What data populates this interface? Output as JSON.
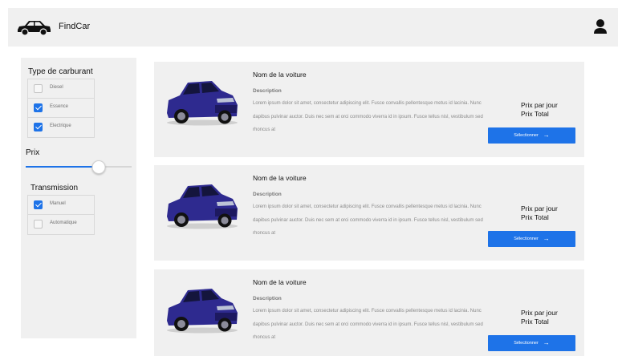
{
  "header": {
    "brand": "FindCar",
    "logo_icon": "car-icon",
    "user_icon": "user-icon"
  },
  "filters": {
    "fuel": {
      "title": "Type de carburant",
      "options": [
        {
          "label": "Diesel",
          "checked": false
        },
        {
          "label": "Essence",
          "checked": true
        },
        {
          "label": "Electrique",
          "checked": true
        }
      ]
    },
    "price": {
      "title": "Prix",
      "slider_value_percent": 69
    },
    "transmission": {
      "title": "Transmission",
      "options": [
        {
          "label": "Manuel",
          "checked": true
        },
        {
          "label": "Automatique",
          "checked": false
        }
      ]
    }
  },
  "accent_color": "#1e73e8",
  "cars": [
    {
      "name": "Nom de la voiture",
      "description_title": "Description",
      "description": "Lorem ipsum dolor sit amet, consectetur adipiscing elit. Fusce convallis pellentesque metus id lacinia. Nunc dapibus pulvinar auctor. Duis nec sem at orci commodo viverra id in ipsum. Fusce tellus nisl, vestibulum sed rhoncus at",
      "price_per_day": "Prix par jour",
      "price_total": "Prix Total",
      "button": "Sélectionner",
      "button_icon": "arrow-right-icon"
    },
    {
      "name": "Nom de la voiture",
      "description_title": "Description",
      "description": "Lorem ipsum dolor sit amet, consectetur adipiscing elit. Fusce convallis pellentesque metus id lacinia. Nunc dapibus pulvinar auctor. Duis nec sem at orci commodo viverra id in ipsum. Fusce tellus nisl, vestibulum sed rhoncus at",
      "price_per_day": "Prix par jour",
      "price_total": "Prix Total",
      "button": "Sélectionner",
      "button_icon": "arrow-right-icon"
    },
    {
      "name": "Nom de la voiture",
      "description_title": "Description",
      "description": "Lorem ipsum dolor sit amet, consectetur adipiscing elit. Fusce convallis pellentesque metus id lacinia. Nunc dapibus pulvinar auctor. Duis nec sem at orci commodo viverra id in ipsum. Fusce tellus nisl, vestibulum sed rhoncus at",
      "price_per_day": "Prix par jour",
      "price_total": "Prix Total",
      "button": "Sélectionner",
      "button_icon": "arrow-right-icon"
    }
  ]
}
